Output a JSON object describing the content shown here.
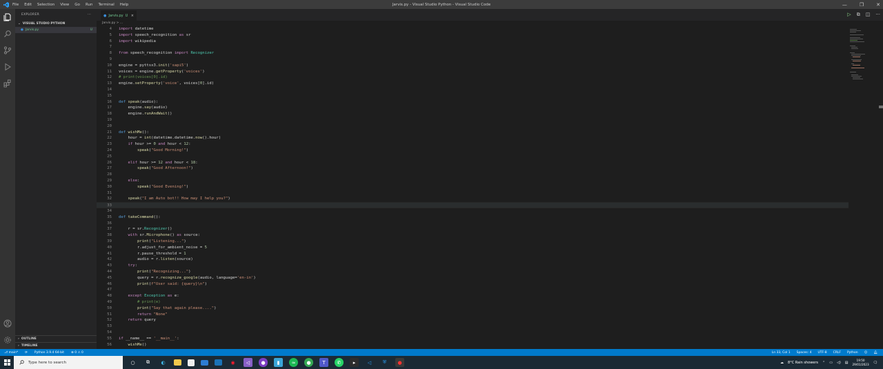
{
  "window": {
    "title": "Jarvis.py - Visual Studio Python - Visual Studio Code",
    "menu": [
      "File",
      "Edit",
      "Selection",
      "View",
      "Go",
      "Run",
      "Terminal",
      "Help"
    ]
  },
  "sidebar": {
    "header": "EXPLORER",
    "more": "···",
    "folder": "VISUAL STUDIO PYTHON",
    "file": "Jarvis.py",
    "file_badge": "U",
    "outline": "OUTLINE",
    "timeline": "TIMELINE"
  },
  "tab": {
    "label": "Jarvis.py",
    "badge": "U",
    "close": "×"
  },
  "breadcrumb": "Jarvis.py > ...",
  "code": [
    {
      "n": "4",
      "t": "import datetime"
    },
    {
      "n": "5",
      "t": "import speech_recognition as sr"
    },
    {
      "n": "6",
      "t": "import wikipedia"
    },
    {
      "n": "7",
      "t": ""
    },
    {
      "n": "8",
      "t": "from speech_recognition import Recognizer"
    },
    {
      "n": "9",
      "t": ""
    },
    {
      "n": "10",
      "t": "engine = pyttsx3.init('sapi5')"
    },
    {
      "n": "11",
      "t": "voices = engine.getProperty('voices')"
    },
    {
      "n": "12",
      "t": "# print(voices[0].id)"
    },
    {
      "n": "13",
      "t": "engine.setProperty('voice', voices[0].id)"
    },
    {
      "n": "14",
      "t": ""
    },
    {
      "n": "15",
      "t": ""
    },
    {
      "n": "16",
      "t": "def speak(audio):"
    },
    {
      "n": "17",
      "t": "    engine.say(audio)"
    },
    {
      "n": "18",
      "t": "    engine.runAndWait()"
    },
    {
      "n": "19",
      "t": ""
    },
    {
      "n": "20",
      "t": ""
    },
    {
      "n": "21",
      "t": "def wishMe():"
    },
    {
      "n": "22",
      "t": "    hour = int(datetime.datetime.now().hour)"
    },
    {
      "n": "23",
      "t": "    if hour >= 0 and hour < 12:"
    },
    {
      "n": "24",
      "t": "        speak(\"Good Morning!\")"
    },
    {
      "n": "25",
      "t": ""
    },
    {
      "n": "26",
      "t": "    elif hour >= 12 and hour < 18:"
    },
    {
      "n": "27",
      "t": "        speak(\"Good Afternoon!\")"
    },
    {
      "n": "28",
      "t": ""
    },
    {
      "n": "29",
      "t": "    else:"
    },
    {
      "n": "30",
      "t": "        speak(\"Good Evening!\")"
    },
    {
      "n": "31",
      "t": ""
    },
    {
      "n": "32",
      "t": "    speak(\"I am Auto bot!! How may I help you?\")"
    },
    {
      "n": "33",
      "t": ""
    },
    {
      "n": "34",
      "t": ""
    },
    {
      "n": "35",
      "t": "def takeCommand():"
    },
    {
      "n": "36",
      "t": ""
    },
    {
      "n": "37",
      "t": "    r = sr.Recognizer()"
    },
    {
      "n": "38",
      "t": "    with sr.Microphone() as source:"
    },
    {
      "n": "39",
      "t": "        print(\"Listening...\")"
    },
    {
      "n": "40",
      "t": "        r.adjust_for_ambient_noise = 5"
    },
    {
      "n": "41",
      "t": "        r.pause_threshold = 1"
    },
    {
      "n": "42",
      "t": "        audio = r.listen(source)"
    },
    {
      "n": "43",
      "t": "    try:"
    },
    {
      "n": "44",
      "t": "        print(\"Recognizing...\")"
    },
    {
      "n": "45",
      "t": "        query = r.recognize_google(audio, language='en-in')"
    },
    {
      "n": "46",
      "t": "        print(f\"User said: {query}\\n\")"
    },
    {
      "n": "47",
      "t": ""
    },
    {
      "n": "48",
      "t": "    except Exception as e:"
    },
    {
      "n": "49",
      "t": "        # print(e)"
    },
    {
      "n": "50",
      "t": "        print(\"Say that again please....\")"
    },
    {
      "n": "51",
      "t": "        return \"None\""
    },
    {
      "n": "52",
      "t": "    return query"
    },
    {
      "n": "53",
      "t": ""
    },
    {
      "n": "54",
      "t": ""
    },
    {
      "n": "55",
      "t": "if __name__ == '__main__':"
    },
    {
      "n": "56",
      "t": "    wishMe()"
    }
  ],
  "status": {
    "branch": "main*",
    "sync": "⟳",
    "interpreter": "Python 3.9.4 64-bit",
    "problems": "⊗ 0 ⚠ 0",
    "cursor": "Ln 33, Col 1",
    "spaces": "Spaces: 4",
    "encoding": "UTF-8",
    "eol": "CRLF",
    "language": "Python"
  },
  "taskbar": {
    "search_placeholder": "Type here to search",
    "weather": "8°C  Rain showers",
    "time": "19:50",
    "date": "29/01/2023"
  },
  "colors": {
    "accent": "#007acc",
    "activity_bar": "#333333",
    "sidebar": "#252526",
    "editor": "#1e1e1e"
  }
}
